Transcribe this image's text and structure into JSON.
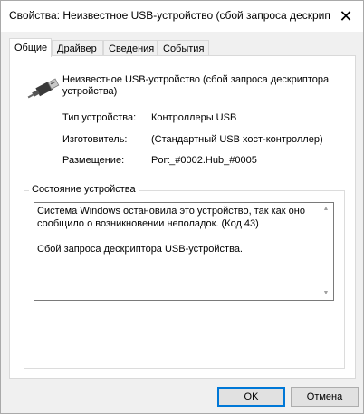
{
  "window": {
    "title": "Свойства: Неизвестное USB-устройство (сбой запроса дескрип",
    "close_glyph": "✕"
  },
  "tabs": [
    {
      "label": "Общие",
      "active": true
    },
    {
      "label": "Драйвер",
      "active": false
    },
    {
      "label": "Сведения",
      "active": false
    },
    {
      "label": "События",
      "active": false
    }
  ],
  "device": {
    "icon": "usb-connector-icon",
    "name": "Неизвестное USB-устройство (сбой запроса дескриптора устройства)"
  },
  "properties": [
    {
      "label": "Тип устройства:",
      "value": "Контроллеры USB"
    },
    {
      "label": "Изготовитель:",
      "value": "(Стандартный USB хост-контроллер)"
    },
    {
      "label": "Размещение:",
      "value": "Port_#0002.Hub_#0005"
    }
  ],
  "status": {
    "legend": "Состояние устройства",
    "line1": "Система Windows остановила это устройство, так как оно сообщило о возникновении неполадок. (Код 43)",
    "line2": "Сбой запроса дескриптора USB-устройства."
  },
  "buttons": {
    "ok": "OK",
    "cancel": "Отмена"
  }
}
